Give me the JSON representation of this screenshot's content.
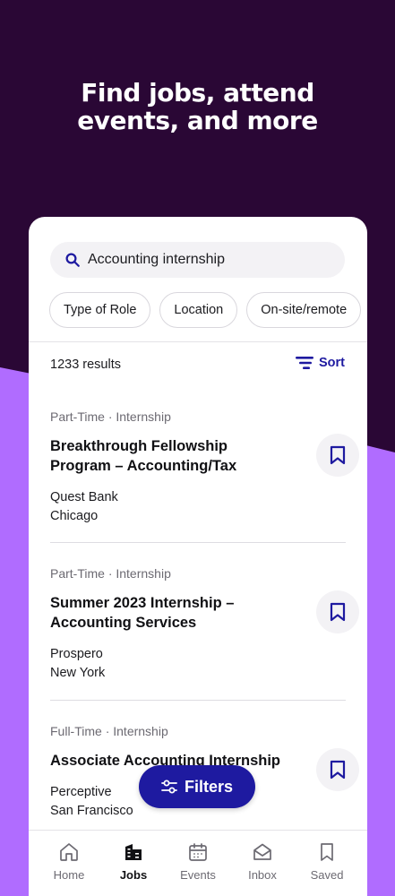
{
  "headline": {
    "line1": "Find jobs, attend",
    "line2": "events, and more"
  },
  "search": {
    "query": "Accounting internship",
    "icon": "search-icon"
  },
  "chips": [
    {
      "label": "Type of Role"
    },
    {
      "label": "Location"
    },
    {
      "label": "On-site/remote"
    }
  ],
  "results": {
    "count_label": "1233 results",
    "sort_label": "Sort"
  },
  "jobs": [
    {
      "meta": "Part-Time · Internship",
      "title": "Breakthrough Fellowship Program – Accounting/Tax",
      "company": "Quest Bank",
      "location": "Chicago"
    },
    {
      "meta": "Part-Time · Internship",
      "title": "Summer 2023 Internship – Accounting Services",
      "company": "Prospero",
      "location": "New York"
    },
    {
      "meta": "Full-Time · Internship",
      "title": "Associate Accounting Internship",
      "company": "Perceptive",
      "location": "San Francisco"
    }
  ],
  "filters_button": {
    "label": "Filters"
  },
  "tabbar": {
    "items": [
      {
        "label": "Home",
        "icon": "home-icon"
      },
      {
        "label": "Jobs",
        "icon": "briefcase-icon",
        "active": true
      },
      {
        "label": "Events",
        "icon": "calendar-icon"
      },
      {
        "label": "Inbox",
        "icon": "envelope-icon"
      },
      {
        "label": "Saved",
        "icon": "bookmark-icon"
      }
    ]
  },
  "colors": {
    "background_dark": "#2a0735",
    "background_accent": "#b06cff",
    "primary": "#1e1aa0",
    "surface": "#ffffff"
  }
}
